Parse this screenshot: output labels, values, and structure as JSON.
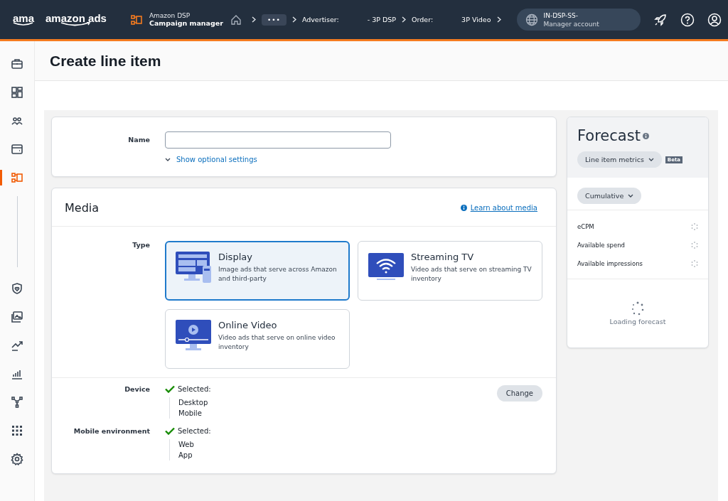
{
  "topbar": {
    "logo_short": "ama",
    "logo": "amazon ads",
    "product": "Amazon DSP",
    "app": "Campaign manager",
    "breadcrumbs": [
      {
        "kind": "home"
      },
      {
        "kind": "more",
        "text": "•••"
      },
      {
        "kind": "pair",
        "label": "Advertiser:",
        "value": "- 3P DSP"
      },
      {
        "kind": "pair",
        "label": "Order:",
        "value": "3P Video"
      }
    ],
    "account": {
      "name": "IN-DSP-SS-",
      "role": "Manager account"
    }
  },
  "sidebar": {
    "top": [
      {
        "kind": "briefcase",
        "selected": false
      },
      {
        "kind": "dashboard",
        "selected": false
      },
      {
        "kind": "people",
        "selected": false
      },
      {
        "kind": "wallet",
        "selected": false
      },
      {
        "kind": "campaign",
        "selected": true
      }
    ],
    "bottom": [
      {
        "kind": "shield",
        "selected": false
      },
      {
        "kind": "images",
        "selected": false
      },
      {
        "kind": "trend",
        "selected": false
      },
      {
        "kind": "bars",
        "selected": false
      },
      {
        "kind": "network",
        "selected": false
      },
      {
        "kind": "apps",
        "selected": false
      },
      {
        "kind": "settings",
        "selected": false
      }
    ]
  },
  "page": {
    "title": "Create line item"
  },
  "name_section": {
    "label": "Name",
    "toggle": "Show optional settings"
  },
  "media": {
    "title": "Media",
    "help_link": "Learn about media",
    "type_label": "Type",
    "types": [
      {
        "kind": "display",
        "title": "Display",
        "description": "Image ads that serve across Amazon and third-party",
        "selected": true
      },
      {
        "kind": "streaming",
        "title": "Streaming TV",
        "description": "Video ads that serve on streaming TV inventory",
        "selected": false
      },
      {
        "kind": "video",
        "title": "Online Video",
        "description": "Video ads that serve on online video inventory",
        "selected": false
      }
    ],
    "settings": [
      {
        "label": "Device",
        "status": "Selected:",
        "values": [
          "Desktop",
          "Mobile"
        ]
      },
      {
        "label": "Mobile environment",
        "status": "Selected:",
        "values": [
          "Web",
          "App"
        ]
      }
    ],
    "change_button": "Change"
  },
  "forecast": {
    "title": "Forecast",
    "metrics_dropdown": "Line item metrics",
    "badge": "Beta",
    "mode_dropdown": "Cumulative",
    "metrics": [
      "eCPM",
      "Available spend",
      "Available impressions"
    ],
    "loading": "Loading forecast"
  }
}
